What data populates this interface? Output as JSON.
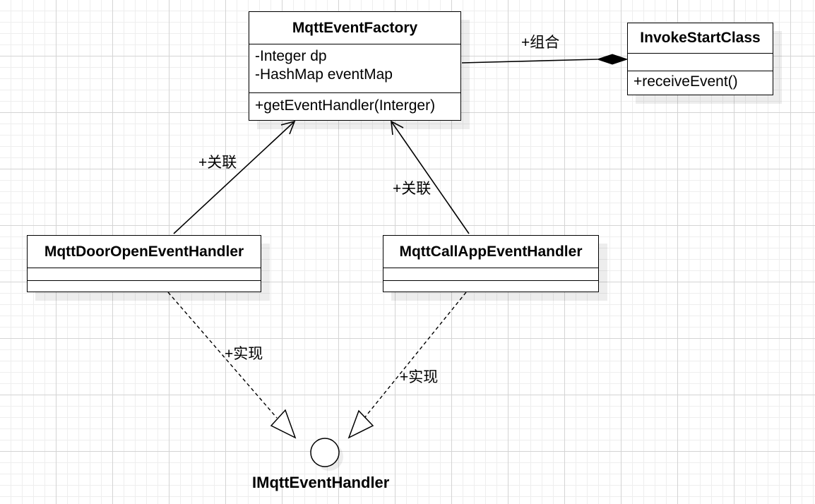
{
  "factory": {
    "name": "MqttEventFactory",
    "attributes": [
      "-Integer dp",
      "-HashMap eventMap"
    ],
    "methods": [
      "+getEventHandler(Interger)"
    ]
  },
  "invoker": {
    "name": "InvokeStartClass",
    "methods": [
      "+receiveEvent()"
    ]
  },
  "door_handler": {
    "name": "MqttDoorOpenEventHandler"
  },
  "call_handler": {
    "name": "MqttCallAppEventHandler"
  },
  "interface": {
    "name": "IMqttEventHandler"
  },
  "relations": {
    "composition": "+组合",
    "assoc_left": "+关联",
    "assoc_right": "+关联",
    "impl_left": "+实现",
    "impl_right": "+实现"
  }
}
